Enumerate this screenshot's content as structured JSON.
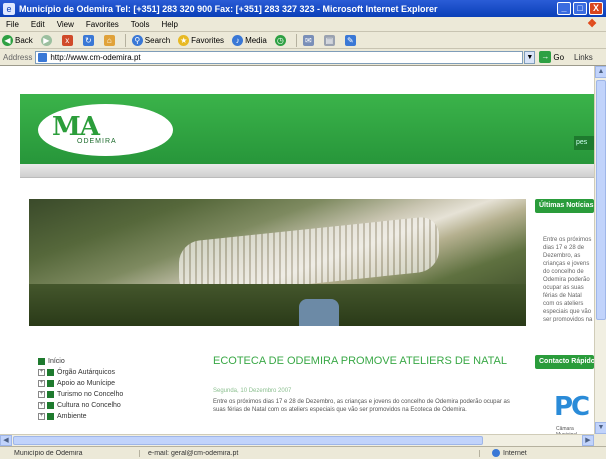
{
  "window": {
    "title": "Município de Odemira   Tel: [+351] 283 320 900   Fax: [+351] 283 327 323 - Microsoft Internet Explorer",
    "controls": {
      "minimize": "_",
      "maximize": "□",
      "close": "X"
    }
  },
  "menubar": {
    "items": [
      "File",
      "Edit",
      "View",
      "Favorites",
      "Tools",
      "Help"
    ]
  },
  "toolbar": {
    "back": "Back",
    "search": "Search",
    "favorites": "Favorites",
    "media": "Media"
  },
  "addressbar": {
    "label": "Address",
    "url": "http://www.cm-odemira.pt",
    "go": "Go",
    "links": "Links"
  },
  "site": {
    "logo": {
      "text": "MA",
      "subtitle": "ODEMIRA"
    },
    "header_button": "pes",
    "sidebar": {
      "news_title": "Últimas Notícias",
      "news_text": "Entre os próximos dias 17 e 28 de Dezembro, as crianças e jovens do concelho de Odemira poderão ocupar as suas férias de Natal com os ateliers especiais que vão ser promovidos na Ecoteca de Odemira.",
      "contact_title": "Contacto Rápido"
    },
    "nav": [
      {
        "label": "Início",
        "type": "bullet"
      },
      {
        "label": "Órgão Autárquicos",
        "type": "plus"
      },
      {
        "label": "Apoio ao Munícipe",
        "type": "plus"
      },
      {
        "label": "Turismo no Concelho",
        "type": "plus"
      },
      {
        "label": "Cultura no Concelho",
        "type": "plus"
      },
      {
        "label": "Ambiente",
        "type": "plus"
      }
    ],
    "article": {
      "title": "ECOTECA DE ODEMIRA PROMOVE ATELIERS DE NATAL",
      "date": "Segunda, 10 Dezembro 2007",
      "body": "Entre os próximos dias 17 e 28 de Dezembro, as crianças e jovens do concelho de Odemira poderão ocupar as suas férias de Natal com os ateliers especiais que vão ser promovidos na Ecoteca de Odemira."
    },
    "partner_logo": {
      "text": "PC",
      "subtitle": "Câmara Municipal"
    }
  },
  "statusbar": {
    "left": "Município de Odemira",
    "middle": "e-mail: geral@cm-odemira.pt",
    "zone": "Internet"
  },
  "colors": {
    "brand_green": "#2a9c3b",
    "xp_blue": "#0a3fb8",
    "chrome": "#ece9d8"
  }
}
